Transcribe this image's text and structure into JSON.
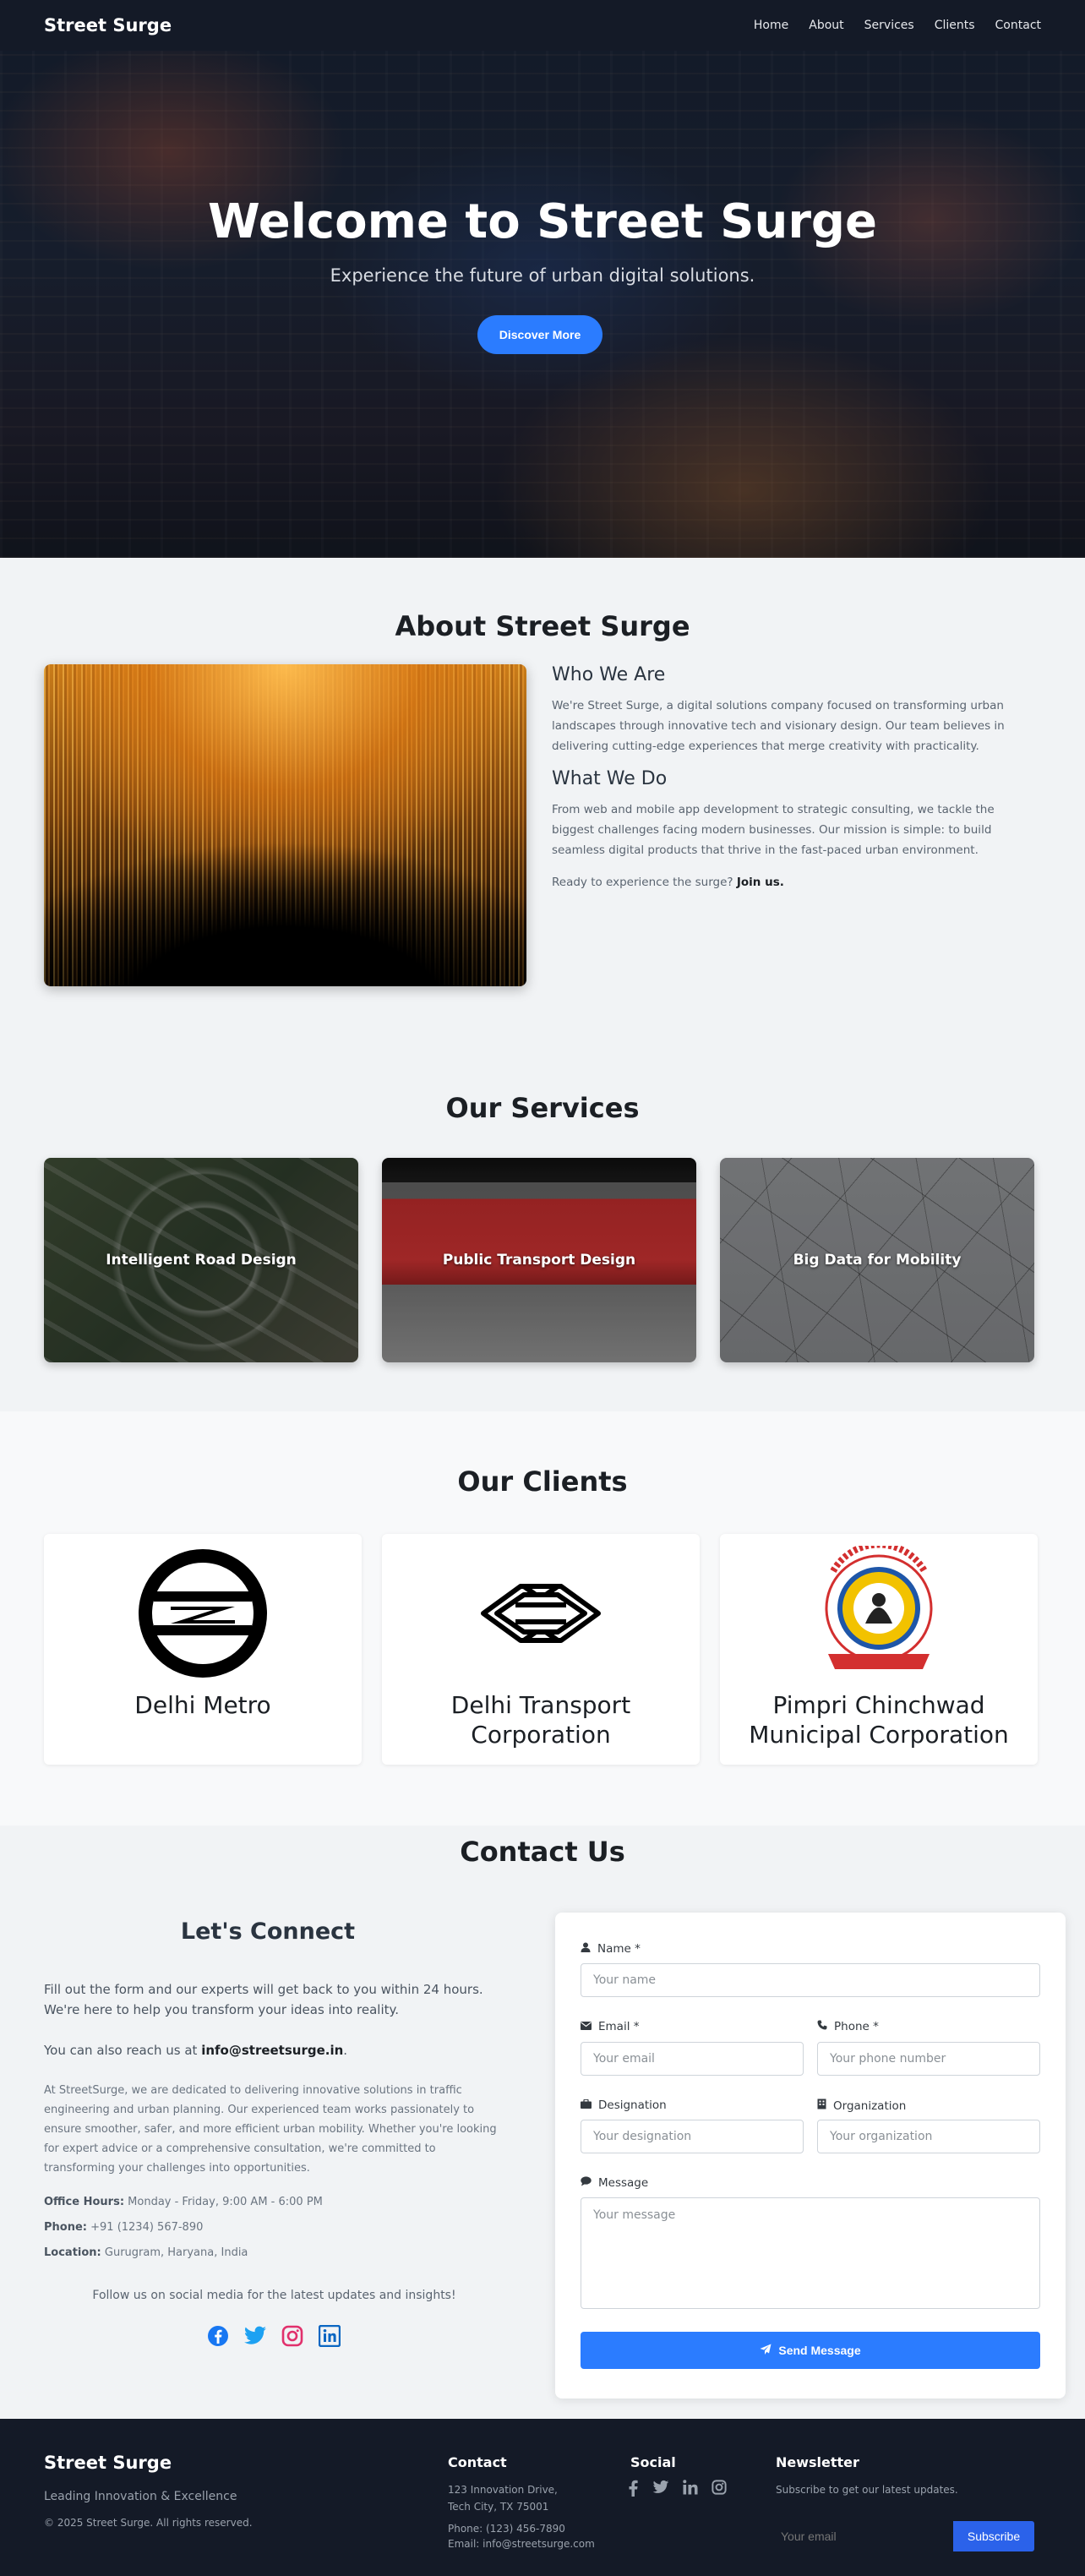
{
  "nav": {
    "brand": "Street Surge",
    "links": [
      "Home",
      "About",
      "Services",
      "Clients",
      "Contact"
    ]
  },
  "hero": {
    "title": "Welcome to Street Surge",
    "subtitle": "Experience the future of urban digital solutions.",
    "button": "Discover More"
  },
  "about": {
    "title": "About Street Surge",
    "who_heading": "Who We Are",
    "who_text": "We're Street Surge, a digital solutions company focused on transforming urban landscapes through innovative tech and visionary design. Our team believes in delivering cutting-edge experiences that merge creativity with practicality.",
    "what_heading": "What We Do",
    "what_text": "From web and mobile app development to strategic consulting, we tackle the biggest challenges facing modern businesses. Our mission is simple: to build seamless digital products that thrive in the fast-paced urban environment.",
    "cta_prefix": "Ready to experience the surge?",
    "cta_link": "Join us."
  },
  "services": {
    "title": "Our Services",
    "items": [
      "Intelligent Road Design",
      "Public Transport Design",
      "Big Data for Mobility"
    ]
  },
  "clients": {
    "title": "Our Clients",
    "items": [
      "Delhi Metro",
      "Delhi Transport Corporation",
      "Pimpri Chinchwad Municipal Corporation"
    ]
  },
  "contact": {
    "title": "Contact Us",
    "connect_title": "Let's Connect",
    "intro": "Fill out the form and our experts will get back to you within 24 hours. We're here to help you transform your ideas into reality.",
    "reach_prefix": "You can also reach us at",
    "reach_email": "info@streetsurge.in",
    "about_text": "At StreetSurge, we are dedicated to delivering innovative solutions in traffic engineering and urban planning. Our experienced team works passionately to ensure smoother, safer, and more efficient urban mobility. Whether you're looking for expert advice or a comprehensive consultation, we're committed to transforming your challenges into opportunities.",
    "office_label": "Office Hours:",
    "office_value": "Monday - Friday, 9:00 AM - 6:00 PM",
    "phone_label": "Phone:",
    "phone_value": "+91 (1234) 567-890",
    "location_label": "Location:",
    "location_value": "Gurugram, Haryana, India",
    "follow": "Follow us on social media for the latest updates and insights!",
    "form": {
      "name_label": "Name *",
      "name_placeholder": "Your name",
      "email_label": "Email *",
      "email_placeholder": "Your email",
      "phone_label": "Phone *",
      "phone_placeholder": "Your phone number",
      "designation_label": "Designation",
      "designation_placeholder": "Your designation",
      "organization_label": "Organization",
      "organization_placeholder": "Your organization",
      "message_label": "Message",
      "message_placeholder": "Your message",
      "submit": "Send Message"
    }
  },
  "footer": {
    "brand": "Street Surge",
    "tagline": "Leading Innovation & Excellence",
    "copyright": "© 2025 Street Surge. All rights reserved.",
    "contact_title": "Contact",
    "address_line1": "123 Innovation Drive,",
    "address_line2": "Tech City, TX 75001",
    "phone": "Phone: (123) 456-7890",
    "email": "Email: info@streetsurge.com",
    "social_title": "Social",
    "newsletter_title": "Newsletter",
    "newsletter_text": "Subscribe to get our latest updates.",
    "newsletter_placeholder": "Your email",
    "subscribe": "Subscribe"
  },
  "colors": {
    "primary": "#2b7cff",
    "nav_bg": "#141a27",
    "facebook": "#1877f2",
    "twitter": "#1da1f2",
    "instagram": "#e1306c",
    "linkedin": "#0a66c2"
  }
}
